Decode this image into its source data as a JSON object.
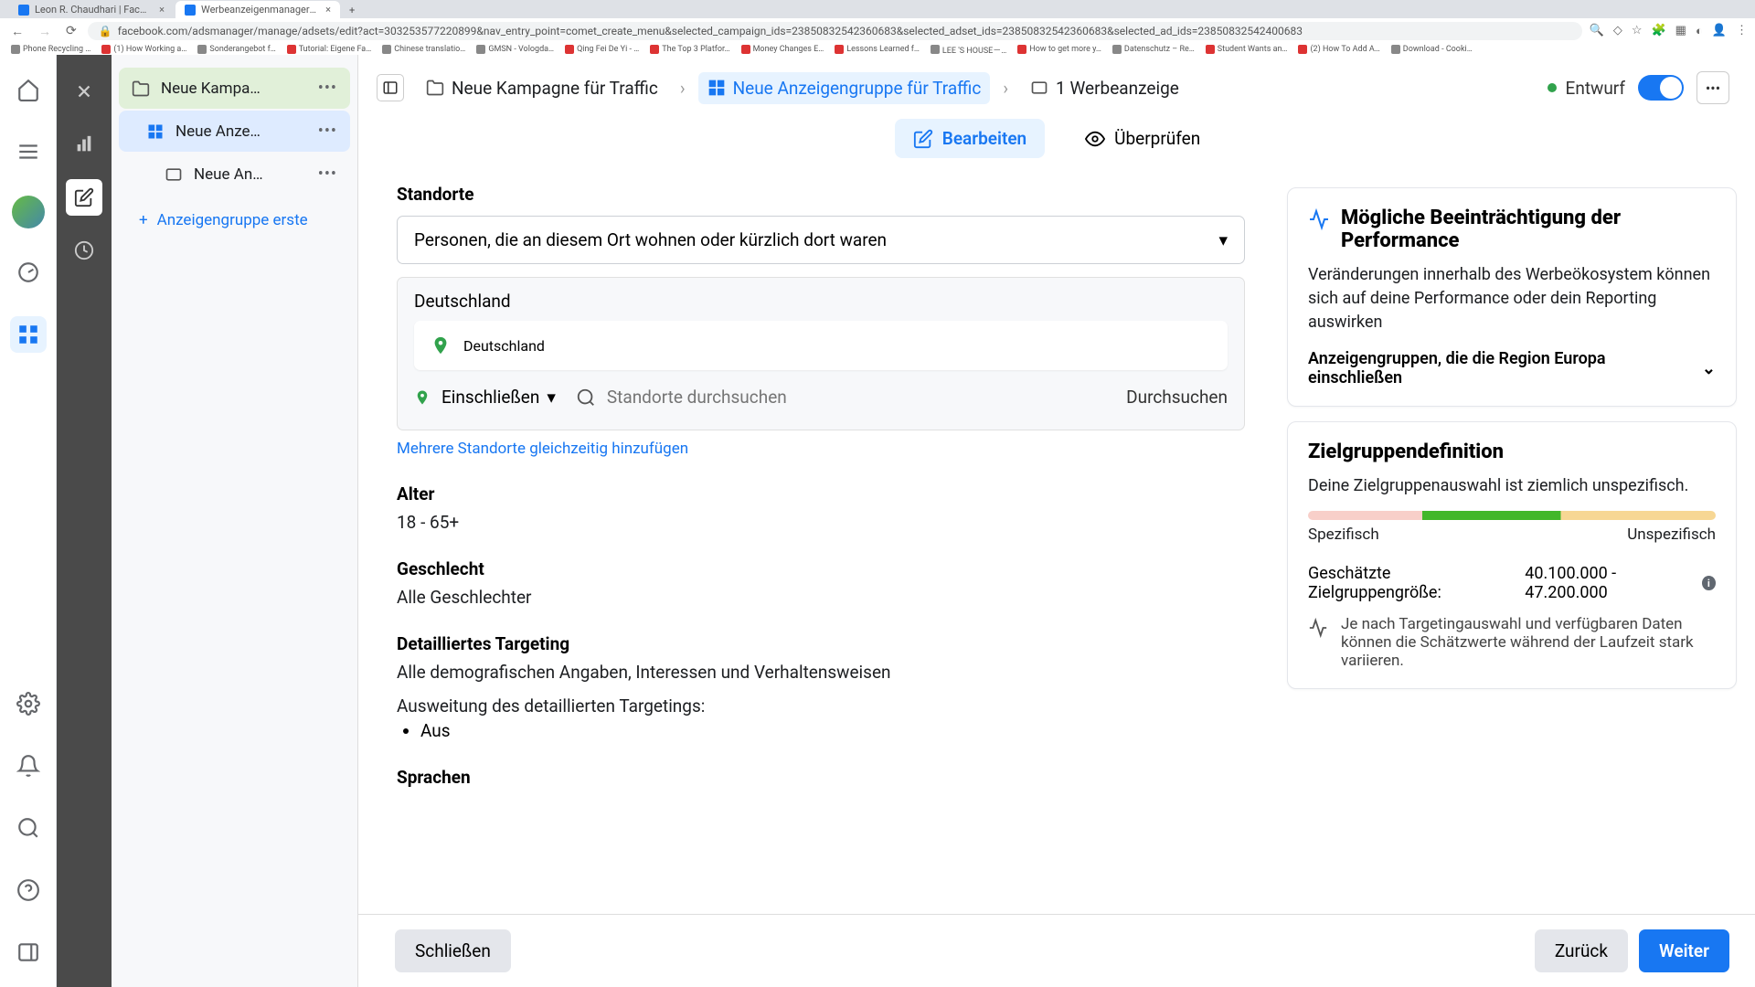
{
  "browser": {
    "tabs": [
      {
        "title": "Leon R. Chaudhari | Facebook"
      },
      {
        "title": "Werbeanzeigenmanager - We…"
      }
    ],
    "url": "facebook.com/adsmanager/manage/adsets/edit?act=303253577220899&nav_entry_point=comet_create_menu&selected_campaign_ids=23850832542360683&selected_adset_ids=23850832542360683&selected_ad_ids=23850832542400683",
    "bookmarks": [
      "Phone Recycling …",
      "(1) How Working a…",
      "Sonderangebot f…",
      "Tutorial: Eigene Fa…",
      "Chinese translatio…",
      "GMSN - Vologda…",
      "Qing Fei De Yi - …",
      "The Top 3 Platfor…",
      "Money Changes E…",
      "Lessons Learned f…",
      "LEE 'S HOUSE－…",
      "How to get more y…",
      "Datenschutz – Re…",
      "Student Wants an…",
      "(2) How To Add A…",
      "Download - Cooki…"
    ]
  },
  "tree": {
    "campaign": "Neue Kampa…",
    "adset": "Neue Anze…",
    "ad": "Neue An…",
    "add_group": "Anzeigengruppe erste"
  },
  "crumbs": {
    "c1": "Neue Kampagne für Traffic",
    "c2": "Neue Anzeigengruppe für Traffic",
    "c3": "1 Werbeanzeige"
  },
  "status": {
    "label": "Entwurf"
  },
  "tabs": {
    "edit": "Bearbeiten",
    "review": "Überprüfen"
  },
  "locations": {
    "heading": "Standorte",
    "dropdown_value": "Personen, die an diesem Ort wohnen oder kürzlich dort waren",
    "group": "Deutschland",
    "chip": "Deutschland",
    "include": "Einschließen",
    "search_placeholder": "Standorte durchsuchen",
    "browse": "Durchsuchen",
    "bulk_link": "Mehrere Standorte gleichzeitig hinzufügen"
  },
  "age": {
    "heading": "Alter",
    "value": "18 - 65+"
  },
  "gender": {
    "heading": "Geschlecht",
    "value": "Alle Geschlechter"
  },
  "targeting": {
    "heading": "Detailliertes Targeting",
    "value": "Alle demografischen Angaben, Interessen und Verhaltensweisen",
    "expansion_label": "Ausweitung des detaillierten Targetings:",
    "expansion_value": "Aus"
  },
  "languages": {
    "heading": "Sprachen"
  },
  "perf": {
    "title": "Mögliche Beeinträchtigung der Performance",
    "body": "Veränderungen innerhalb des Werbeökosystem können sich auf deine Performance oder dein Reporting auswirken",
    "expander": "Anzeigengruppen, die die Region Europa einschließen"
  },
  "audience": {
    "title": "Zielgruppendefinition",
    "summary": "Deine Zielgruppenauswahl ist ziemlich unspezifisch.",
    "specific": "Spezifisch",
    "unspecific": "Unspezifisch",
    "size_label": "Geschätzte Zielgruppengröße:",
    "size_value": "40.100.000 - 47.200.000",
    "note": "Je nach Targetingauswahl und verfügbaren Daten können die Schätzwerte während der Laufzeit stark variieren."
  },
  "footer": {
    "close": "Schließen",
    "back": "Zurück",
    "next": "Weiter"
  }
}
